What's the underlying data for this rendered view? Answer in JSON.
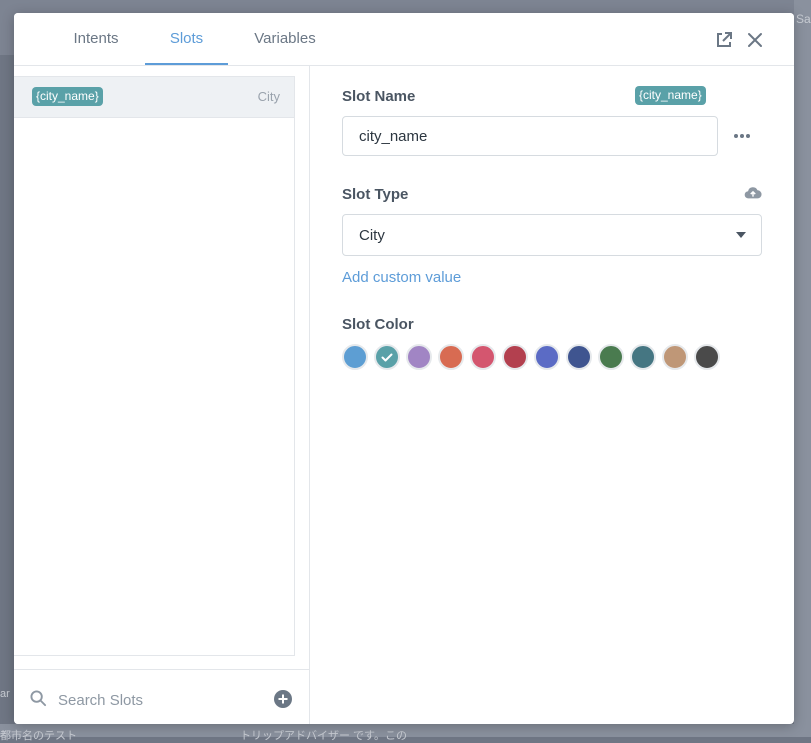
{
  "background": {
    "top_right_fragment": "Sa",
    "left_fragment": "ar",
    "bottom_fragment_1": "都市名のテスト",
    "bottom_fragment_2": "トリップアドバイザー です。この"
  },
  "tabs": [
    {
      "label": "Intents",
      "active": false
    },
    {
      "label": "Slots",
      "active": true
    },
    {
      "label": "Variables",
      "active": false
    }
  ],
  "header_icons": [
    "external-link-icon",
    "close-icon"
  ],
  "slot_list": [
    {
      "tag": "{city_name}",
      "type": "City",
      "selected": true
    }
  ],
  "search": {
    "placeholder": "Search Slots",
    "value": ""
  },
  "detail": {
    "slot_name_label": "Slot Name",
    "slot_name_tag": "{city_name}",
    "slot_name_value": "city_name",
    "slot_type_label": "Slot Type",
    "slot_type_value": "City",
    "add_custom_value": "Add custom value",
    "slot_color_label": "Slot Color"
  },
  "colors": {
    "accent": "#5d9cd8",
    "tag_bg": "#5aa1a8",
    "swatches": [
      "#5d9ed3",
      "#5aa1a8",
      "#a185c4",
      "#d86b52",
      "#d4566f",
      "#b3404f",
      "#5b6bc5",
      "#3f5590",
      "#4a7b4f",
      "#457682",
      "#bf9777",
      "#4a4a4a"
    ],
    "selected_swatch_index": 1
  }
}
